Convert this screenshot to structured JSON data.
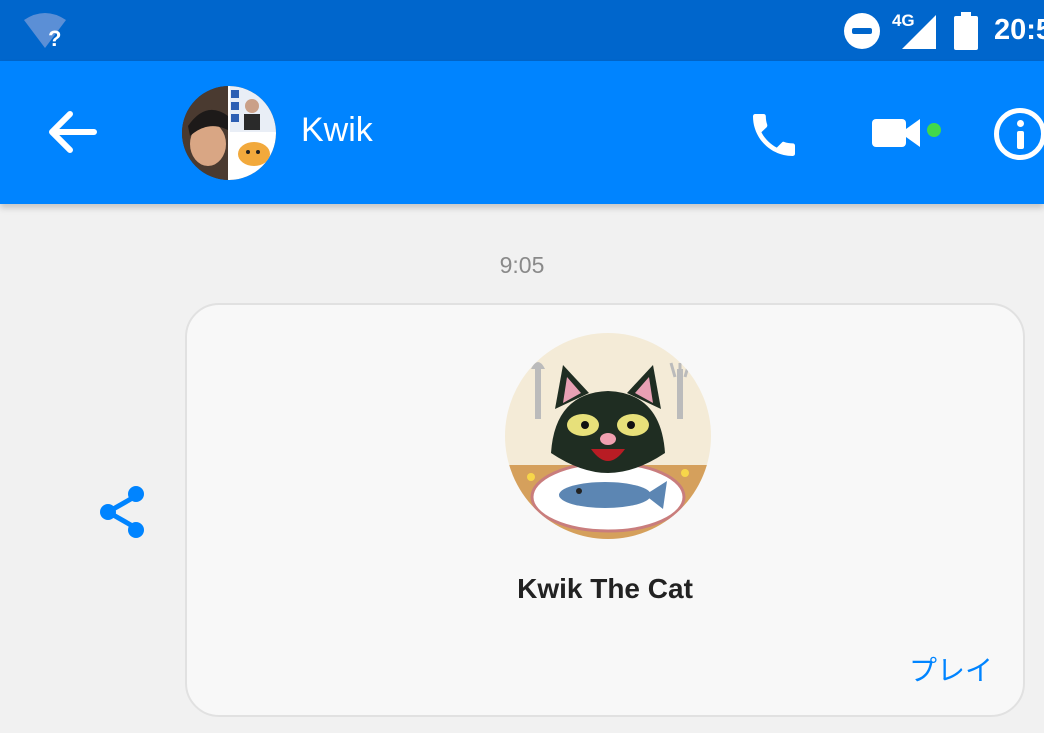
{
  "status_bar": {
    "wifi_mark": "?",
    "network_type": "4G",
    "time": "20:5",
    "icons": [
      "wifi-unknown-icon",
      "do-not-disturb-icon",
      "cell-signal-icon",
      "battery-icon"
    ]
  },
  "header": {
    "contact_name": "Kwik",
    "online": true,
    "icons": [
      "back-arrow-icon",
      "phone-icon",
      "video-camera-icon",
      "info-icon"
    ],
    "colors": {
      "bar": "#0084ff",
      "status_bar": "#0066cc",
      "online_dot": "#42d84a"
    }
  },
  "conversation": {
    "timestamp": "9:05",
    "game_card": {
      "title": "Kwik The Cat",
      "play_label": "プレイ",
      "accent": "#0084ff"
    },
    "share_icon": "share-icon"
  }
}
